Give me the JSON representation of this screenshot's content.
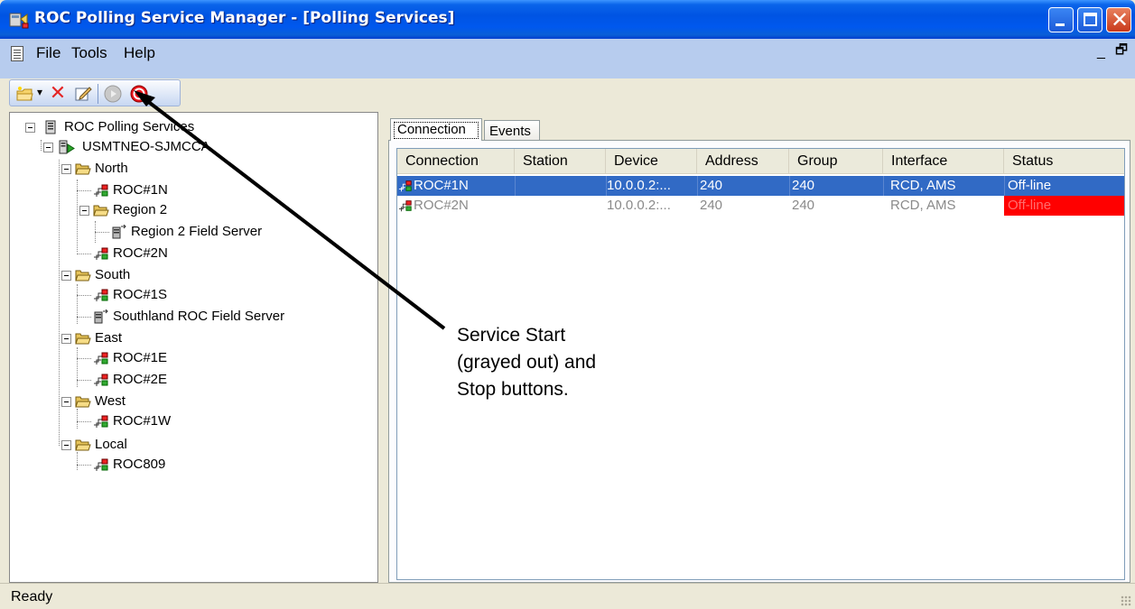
{
  "window": {
    "title": "ROC Polling Service Manager - [Polling Services]",
    "controls": {
      "minimize": "minimize-icon",
      "maximize": "maximize-icon",
      "close": "close-icon"
    }
  },
  "menu": {
    "items": [
      "File",
      "Tools",
      "Help"
    ],
    "mdi_min": "_",
    "mdi_restore": "🗗"
  },
  "toolbar": {
    "buttons": [
      {
        "name": "new",
        "icon": "folder-new-icon",
        "enabled": true
      },
      {
        "name": "delete",
        "icon": "delete-x-icon",
        "enabled": true
      },
      {
        "name": "edit",
        "icon": "edit-icon",
        "enabled": true
      },
      {
        "name": "service-start",
        "icon": "play-icon",
        "enabled": false
      },
      {
        "name": "service-stop",
        "icon": "stop-icon",
        "enabled": true
      }
    ],
    "delete_glyph": "✕"
  },
  "tree": {
    "root": "ROC Polling Services",
    "server": "USMTNEO-SJMCCA",
    "nodes": [
      {
        "label": "North",
        "type": "folder"
      },
      {
        "label": "ROC#1N",
        "type": "device"
      },
      {
        "label": "Region 2",
        "type": "folder"
      },
      {
        "label": "Region 2 Field Server",
        "type": "field-server"
      },
      {
        "label": "ROC#2N",
        "type": "device"
      },
      {
        "label": "South",
        "type": "folder"
      },
      {
        "label": "ROC#1S",
        "type": "device"
      },
      {
        "label": "Southland ROC Field Server",
        "type": "field-server"
      },
      {
        "label": "East",
        "type": "folder"
      },
      {
        "label": "ROC#1E",
        "type": "device"
      },
      {
        "label": "ROC#2E",
        "type": "device"
      },
      {
        "label": "West",
        "type": "folder"
      },
      {
        "label": "ROC#1W",
        "type": "device"
      },
      {
        "label": "Local",
        "type": "folder"
      },
      {
        "label": "ROC809",
        "type": "device"
      }
    ]
  },
  "tabs": [
    "Connection",
    "Events"
  ],
  "table": {
    "columns": [
      "Connection",
      "Station",
      "Device",
      "Address",
      "Group",
      "Interface",
      "Status"
    ],
    "rows": [
      {
        "connection": "ROC#1N",
        "station": "",
        "device": "10.0.0.2:...",
        "address": "240",
        "group": "240",
        "interface": "RCD, AMS",
        "status": "Off-line",
        "selected": true
      },
      {
        "connection": "ROC#2N",
        "station": "",
        "device": "10.0.0.2:...",
        "address": "240",
        "group": "240",
        "interface": "RCD, AMS",
        "status": "Off-line",
        "selected": false,
        "status_color": "#ff0000"
      }
    ]
  },
  "statusbar": {
    "text": "Ready"
  },
  "callout": {
    "lines": [
      "Service Start",
      "(grayed out) and",
      "Stop buttons."
    ]
  }
}
